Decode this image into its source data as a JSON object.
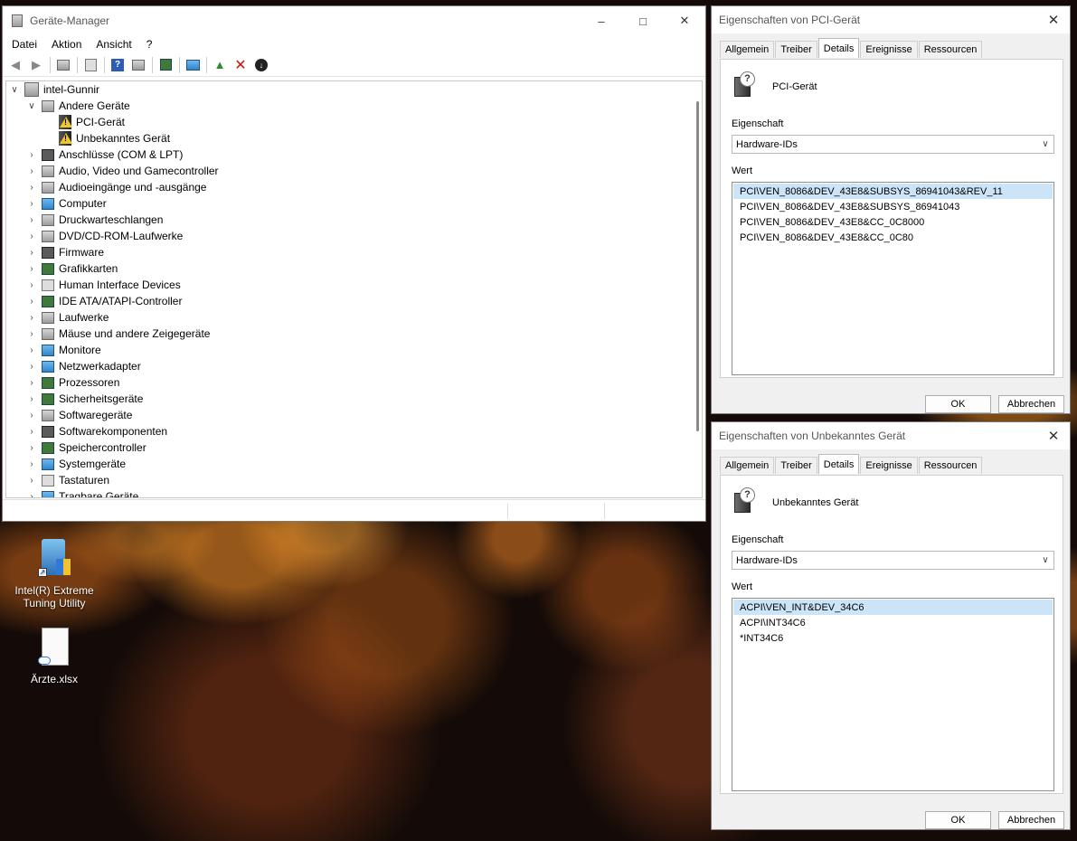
{
  "device_manager": {
    "title": "Geräte-Manager",
    "menu": [
      "Datei",
      "Aktion",
      "Ansicht",
      "?"
    ],
    "root": "intel-Gunnir",
    "tree": [
      {
        "label": "Andere Geräte",
        "expanded": true,
        "indent": 1,
        "icon": "unknown-device-icon"
      },
      {
        "label": "PCI-Gerät",
        "indent": 2,
        "icon": "warning-device-icon"
      },
      {
        "label": "Unbekanntes Gerät",
        "indent": 2,
        "icon": "warning-device-icon"
      },
      {
        "label": "Anschlüsse (COM & LPT)",
        "indent": 1,
        "icon": "port-icon"
      },
      {
        "label": "Audio, Video und Gamecontroller",
        "indent": 1,
        "icon": "speaker-icon"
      },
      {
        "label": "Audioeingänge und -ausgänge",
        "indent": 1,
        "icon": "speaker-icon"
      },
      {
        "label": "Computer",
        "indent": 1,
        "icon": "computer-icon"
      },
      {
        "label": "Druckwarteschlangen",
        "indent": 1,
        "icon": "printer-icon"
      },
      {
        "label": "DVD/CD-ROM-Laufwerke",
        "indent": 1,
        "icon": "dvd-drive-icon"
      },
      {
        "label": "Firmware",
        "indent": 1,
        "icon": "chip-icon"
      },
      {
        "label": "Grafikkarten",
        "indent": 1,
        "icon": "display-adapter-icon"
      },
      {
        "label": "Human Interface Devices",
        "indent": 1,
        "icon": "hid-icon"
      },
      {
        "label": "IDE ATA/ATAPI-Controller",
        "indent": 1,
        "icon": "ide-controller-icon"
      },
      {
        "label": "Laufwerke",
        "indent": 1,
        "icon": "disk-drive-icon"
      },
      {
        "label": "Mäuse und andere Zeigegeräte",
        "indent": 1,
        "icon": "mouse-icon"
      },
      {
        "label": "Monitore",
        "indent": 1,
        "icon": "monitor-icon"
      },
      {
        "label": "Netzwerkadapter",
        "indent": 1,
        "icon": "network-adapter-icon"
      },
      {
        "label": "Prozessoren",
        "indent": 1,
        "icon": "processor-icon"
      },
      {
        "label": "Sicherheitsgeräte",
        "indent": 1,
        "icon": "security-device-icon"
      },
      {
        "label": "Softwaregeräte",
        "indent": 1,
        "icon": "software-device-icon"
      },
      {
        "label": "Softwarekomponenten",
        "indent": 1,
        "icon": "software-component-icon"
      },
      {
        "label": "Speichercontroller",
        "indent": 1,
        "icon": "storage-controller-icon"
      },
      {
        "label": "Systemgeräte",
        "indent": 1,
        "icon": "system-device-icon"
      },
      {
        "label": "Tastaturen",
        "indent": 1,
        "icon": "keyboard-icon"
      },
      {
        "label": "Tragbare Geräte",
        "indent": 1,
        "icon": "portable-device-icon"
      }
    ]
  },
  "dialog_pci": {
    "title": "Eigenschaften von PCI-Gerät",
    "tabs": [
      "Allgemein",
      "Treiber",
      "Details",
      "Ereignisse",
      "Ressourcen"
    ],
    "active_tab": "Details",
    "device_name": "PCI-Gerät",
    "property_label": "Eigenschaft",
    "property_value": "Hardware-IDs",
    "value_label": "Wert",
    "values": [
      "PCI\\VEN_8086&DEV_43E8&SUBSYS_86941043&REV_11",
      "PCI\\VEN_8086&DEV_43E8&SUBSYS_86941043",
      "PCI\\VEN_8086&DEV_43E8&CC_0C8000",
      "PCI\\VEN_8086&DEV_43E8&CC_0C80"
    ],
    "ok": "OK",
    "cancel": "Abbrechen"
  },
  "dialog_unknown": {
    "title": "Eigenschaften von Unbekanntes Gerät",
    "tabs": [
      "Allgemein",
      "Treiber",
      "Details",
      "Ereignisse",
      "Ressourcen"
    ],
    "active_tab": "Details",
    "device_name": "Unbekanntes Gerät",
    "property_label": "Eigenschaft",
    "property_value": "Hardware-IDs",
    "value_label": "Wert",
    "values": [
      "ACPI\\VEN_INT&DEV_34C6",
      "ACPI\\INT34C6",
      "*INT34C6"
    ],
    "ok": "OK",
    "cancel": "Abbrechen"
  },
  "desktop": {
    "icons": [
      {
        "label": "Intel(R) Extreme Tuning Utility"
      },
      {
        "label": "Ärzte.xlsx"
      }
    ]
  },
  "colors": {
    "selection": "#cce4f7",
    "warning": "#f3c52c",
    "delete": "#d01010"
  }
}
